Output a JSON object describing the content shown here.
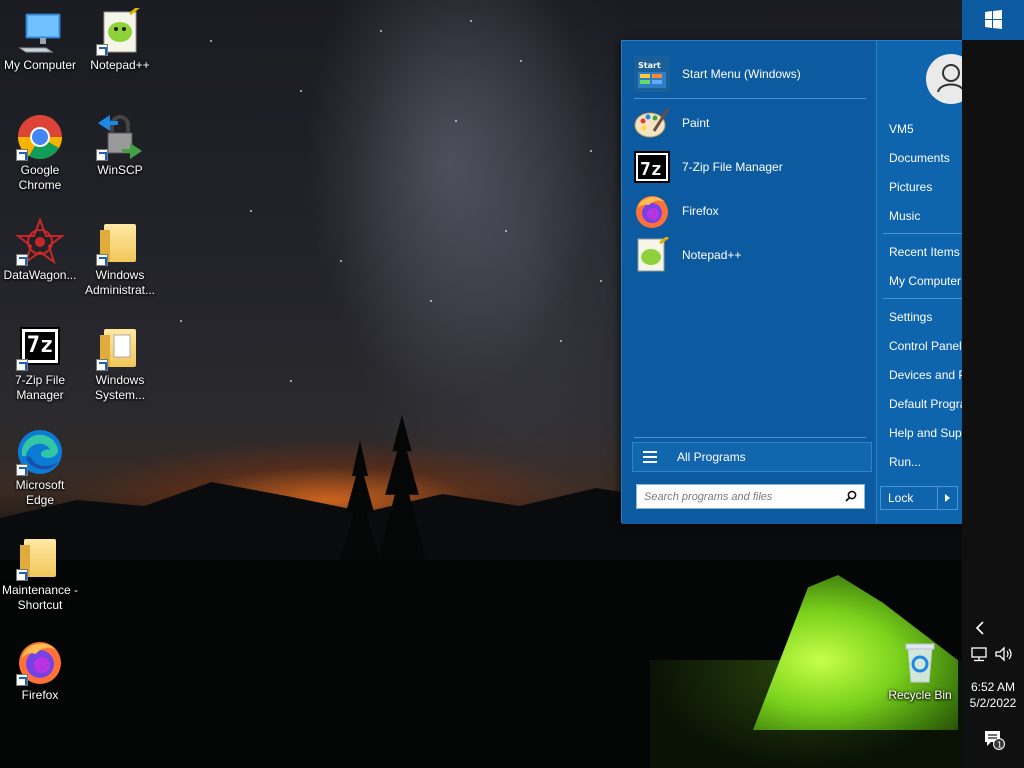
{
  "desktop": {
    "icons": [
      {
        "label": "My Computer"
      },
      {
        "label": "Notepad++"
      },
      {
        "label": "Google Chrome"
      },
      {
        "label": "WinSCP"
      },
      {
        "label": "DataWagon..."
      },
      {
        "label": "Windows Administrat..."
      },
      {
        "label": "7-Zip File Manager"
      },
      {
        "label": "Windows System..."
      },
      {
        "label": "Microsoft Edge"
      },
      {
        "label": "Maintenance - Shortcut"
      },
      {
        "label": "Firefox"
      },
      {
        "label": "Recycle Bin"
      }
    ]
  },
  "start_menu": {
    "pinned": [
      {
        "label": "Start Menu (Windows)",
        "icon": "start-menu-icon",
        "icon_text": "Start"
      },
      {
        "label": "Paint",
        "icon": "paint-icon"
      },
      {
        "label": "7-Zip File Manager",
        "icon": "7zip-icon",
        "icon_text": "7z"
      },
      {
        "label": "Firefox",
        "icon": "firefox-icon"
      },
      {
        "label": "Notepad++",
        "icon": "notepadpp-icon"
      }
    ],
    "all_programs_label": "All Programs",
    "search_placeholder": "Search programs and files",
    "right_links": {
      "user": "VM5",
      "documents": "Documents",
      "pictures": "Pictures",
      "music": "Music",
      "recent_items": "Recent Items",
      "my_computer": "My Computer",
      "settings": "Settings",
      "control_panel": "Control Panel",
      "devices_printers": "Devices and Printers",
      "default_programs": "Default Programs",
      "help_support": "Help and Support",
      "run": "Run..."
    },
    "lock_label": "Lock"
  },
  "taskbar": {
    "time": "6:52 AM",
    "date": "5/2/2022",
    "notification_count": "1"
  },
  "colors": {
    "menu_blue": "#0c5ba0",
    "menu_right_blue": "#0e64ad",
    "taskbar": "#101010"
  }
}
